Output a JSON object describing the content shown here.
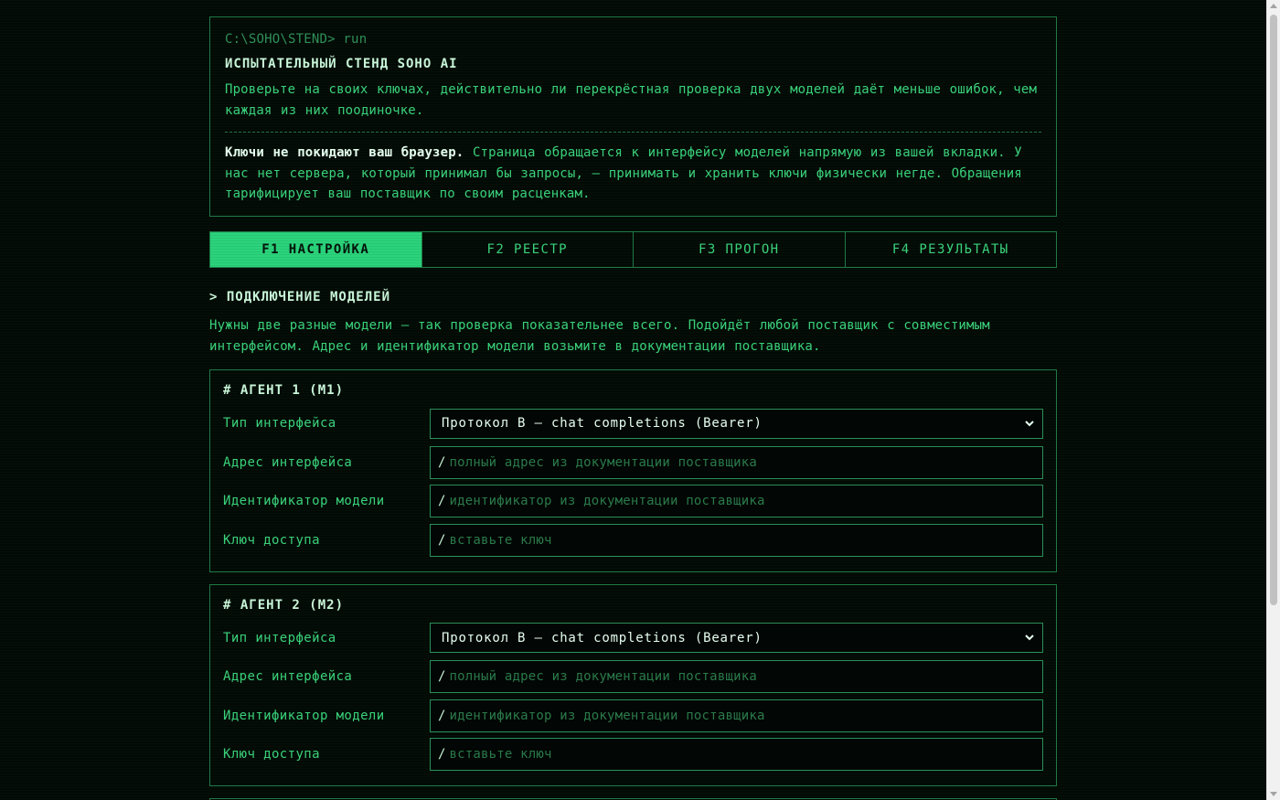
{
  "intro": {
    "prompt": "C:\\SOHO\\STEND> run",
    "title": "ИСПЫТАТЕЛЬНЫЙ СТЕНД SOHO AI",
    "description": "Проверьте на своих ключах, действительно ли перекрёстная проверка двух моделей даёт меньше ошибок, чем каждая из них поодиночке.",
    "privacy_strong": "Ключи не покидают ваш браузер.",
    "privacy_text": " Страница обращается к интерфейсу моделей напрямую из вашей вкладки. У нас нет сервера, который принимал бы запросы, — принимать и хранить ключи физически негде. Обращения тарифицирует ваш поставщик по своим расценкам."
  },
  "tabs": [
    {
      "label": "F1 НАСТРОЙКА",
      "active": true
    },
    {
      "label": "F2 РЕЕСТР",
      "active": false
    },
    {
      "label": "F3 ПРОГОН",
      "active": false
    },
    {
      "label": "F4 РЕЗУЛЬТАТЫ",
      "active": false
    }
  ],
  "section": {
    "title": "> ПОДКЛЮЧЕНИЕ МОДЕЛЕЙ",
    "description": "Нужны две разные модели — так проверка показательнее всего. Подойдёт любой поставщик с совместимым интерфейсом. Адрес и идентификатор модели возьмите в документации поставщика."
  },
  "agents": [
    {
      "title": "# АГЕНТ 1 (M1)",
      "interface_type_label": "Тип интерфейса",
      "interface_type_value": "Протокол B — chat completions (Bearer)",
      "address_label": "Адрес интерфейса",
      "address_value": "",
      "address_placeholder": "полный адрес из документации поставщика",
      "model_id_label": "Идентификатор модели",
      "model_id_value": "",
      "model_id_placeholder": "идентификатор из документации поставщика",
      "key_label": "Ключ доступа",
      "key_value": "",
      "key_placeholder": "вставьте ключ"
    },
    {
      "title": "# АГЕНТ 2 (M2)",
      "interface_type_label": "Тип интерфейса",
      "interface_type_value": "Протокол B — chat completions (Bearer)",
      "address_label": "Адрес интерфейса",
      "address_value": "",
      "address_placeholder": "полный адрес из документации поставщика",
      "model_id_label": "Идентификатор модели",
      "model_id_value": "",
      "model_id_placeholder": "идентификатор из документации поставщика",
      "key_label": "Ключ доступа",
      "key_value": "",
      "key_placeholder": "вставьте ключ"
    }
  ],
  "input_prefix": "/",
  "colors": {
    "background": "#030a05",
    "text": "#3ad17a",
    "accent": "#2bd47c",
    "border": "#1f7a45",
    "bright_text": "#c8f5d8"
  },
  "icons": {
    "select_chevron": "chevron-down-icon"
  }
}
